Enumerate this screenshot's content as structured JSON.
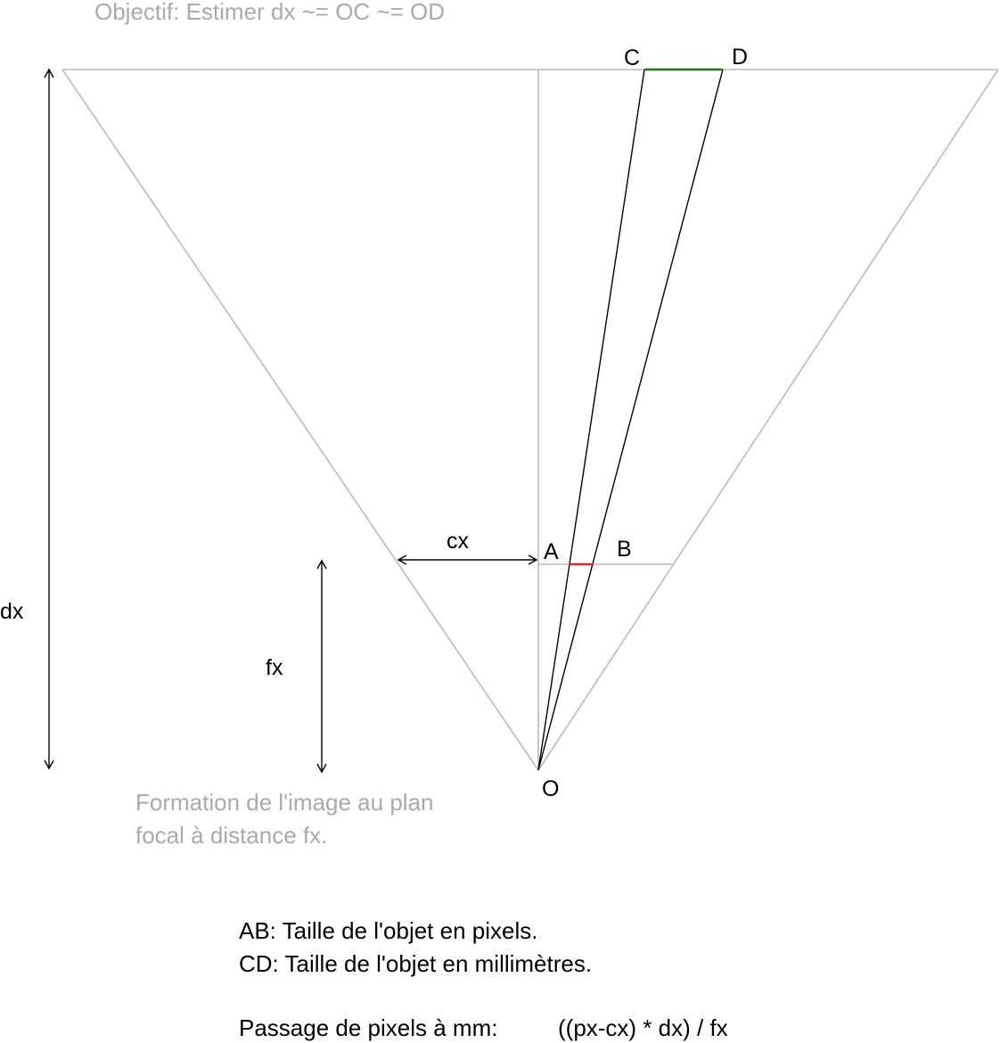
{
  "title": "Objectif: Estimer dx ~=  OC ~= OD",
  "points": {
    "A": "A",
    "B": "B",
    "C": "C",
    "D": "D",
    "O": "O"
  },
  "dimensions": {
    "dx": "dx",
    "fx": "fx",
    "cx": "cx"
  },
  "focal_note": {
    "line1": "Formation de l'image au plan",
    "line2": "focal à distance fx."
  },
  "legend": {
    "ab": "AB: Taille de l'objet en pixels.",
    "cd": "CD: Taille de l'objet en millimètres.",
    "formula_label": "Passage de pixels à mm:",
    "formula": "((px-cx) * dx) / fx"
  },
  "colors": {
    "construction": "#bbbbbb",
    "ray": "#000000",
    "object_mm": "#1a7a1a",
    "object_px": "#dd2222",
    "note_text": "#aaaaaa"
  }
}
